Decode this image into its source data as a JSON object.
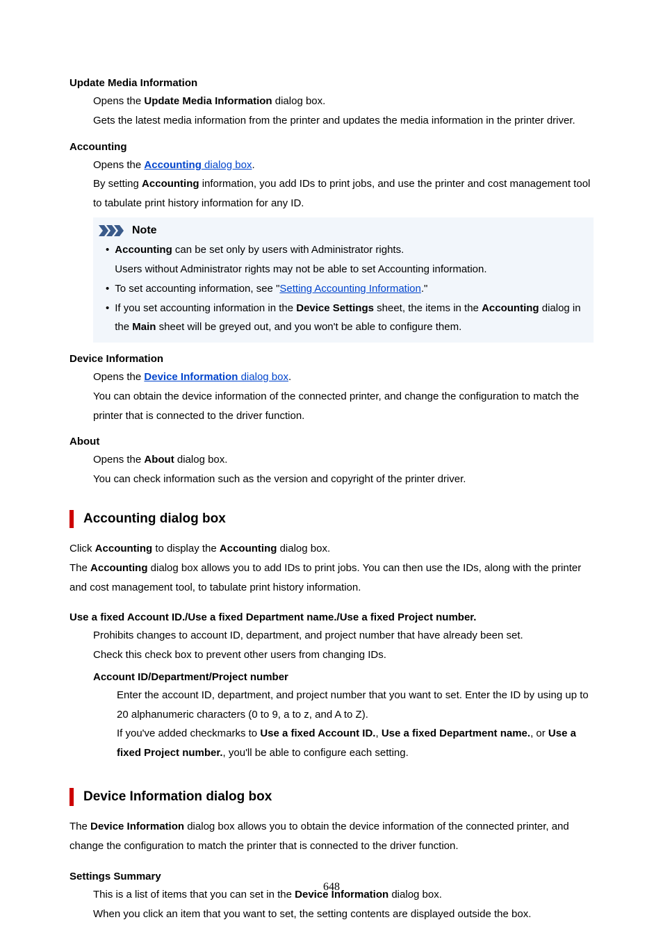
{
  "updateMedia": {
    "title": "Update Media Information",
    "l1a": "Opens the ",
    "l1b": "Update Media Information",
    "l1c": " dialog box.",
    "l2": "Gets the latest media information from the printer and updates the media information in the printer driver."
  },
  "accounting": {
    "title": "Accounting",
    "l1a": "Opens the ",
    "link1": "Accounting",
    "link2": " dialog box",
    "l1d": ".",
    "l2a": "By setting ",
    "l2b": "Accounting",
    "l2c": " information, you add IDs to print jobs, and use the printer and cost management tool to tabulate print history information for any ID."
  },
  "note": {
    "title": "Note",
    "b1a": "Accounting",
    "b1b": " can be set only by users with Administrator rights.",
    "b1c": "Users without Administrator rights may not be able to set Accounting information.",
    "b2a": "To set accounting information, see \"",
    "b2link": "Setting Accounting Information",
    "b2c": ".\"",
    "b3a": "If you set accounting information in the ",
    "b3b": "Device Settings",
    "b3c": " sheet, the items in the ",
    "b3d": "Accounting",
    "b3e": " dialog in the ",
    "b3f": "Main",
    "b3g": " sheet will be greyed out, and you won't be able to configure them."
  },
  "devInfo": {
    "title": "Device Information",
    "l1a": "Opens the ",
    "link1": "Device Information",
    "link2": " dialog box",
    "l1d": ".",
    "l2": "You can obtain the device information of the connected printer, and change the configuration to match the printer that is connected to the driver function."
  },
  "about": {
    "title": "About",
    "l1a": "Opens the ",
    "l1b": "About",
    "l1c": " dialog box.",
    "l2": "You can check information such as the version and copyright of the printer driver."
  },
  "acctSection": {
    "title": "Accounting dialog box",
    "p1a": "Click ",
    "p1b": "Accounting",
    "p1c": " to display the ",
    "p1d": "Accounting",
    "p1e": " dialog box.",
    "p2a": "The ",
    "p2b": "Accounting",
    "p2c": " dialog box allows you to add IDs to print jobs. You can then use the IDs, along with the printer and cost management tool, to tabulate print history information.",
    "dt1": "Use a fixed Account ID./Use a fixed Department name./Use a fixed Project number.",
    "dd1a": "Prohibits changes to account ID, department, and project number that have already been set.",
    "dd1b": "Check this check box to prevent other users from changing IDs.",
    "dt2": "Account ID/Department/Project number",
    "dd2a": "Enter the account ID, department, and project number that you want to set. Enter the ID by using up to 20 alphanumeric characters (0 to 9, a to z, and A to Z).",
    "dd2b1": "If you've added checkmarks to ",
    "dd2b2": "Use a fixed Account ID.",
    "dd2b3": ", ",
    "dd2b4": "Use a fixed Department name.",
    "dd2b5": ", or ",
    "dd2b6": "Use a fixed Project number.",
    "dd2b7": ", you'll be able to configure each setting."
  },
  "devSection": {
    "title": "Device Information dialog box",
    "p1a": "The ",
    "p1b": "Device Information",
    "p1c": " dialog box allows you to obtain the device information of the connected printer, and change the configuration to match the printer that is connected to the driver function.",
    "dt1": "Settings Summary",
    "dd1a1": "This is a list of items that you can set in the ",
    "dd1a2": "Device Information",
    "dd1a3": " dialog box.",
    "dd1b": "When you click an item that you want to set, the setting contents are displayed outside the box."
  },
  "pageNum": "648"
}
